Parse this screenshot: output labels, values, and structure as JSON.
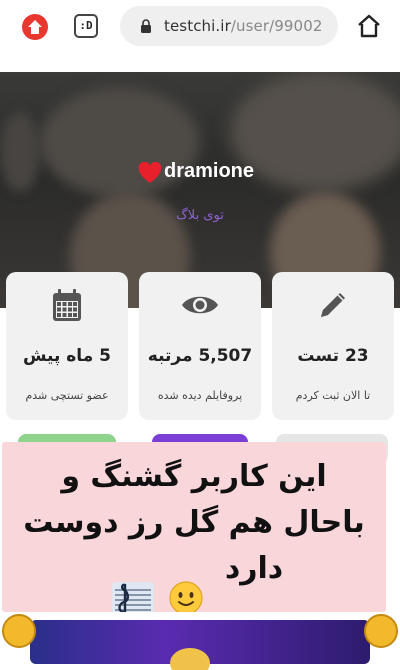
{
  "browser": {
    "url_domain": "testchi.ir",
    "url_path": "/user/99002",
    "tab_badge": ":D"
  },
  "profile": {
    "username": "dramione",
    "subtitle": "توی بلاگ"
  },
  "stats": [
    {
      "icon": "pencil-icon",
      "value": "23 تست",
      "label": "تا الان ثبت کردم"
    },
    {
      "icon": "eye-icon",
      "value": "5,507 مرتبه",
      "label": "پروفایلم دیده شده"
    },
    {
      "icon": "calendar-icon",
      "value": "5 ماه پیش",
      "label": "عضو تستچی شدم"
    }
  ],
  "banner": {
    "line1": "این کاربر گشنگ و",
    "line2": "باحال هم گل رز دوست",
    "line3": "دارد"
  },
  "colors": {
    "accent": "#8a62d6",
    "banner": "#f9d6d9",
    "home": "#e7372f"
  }
}
